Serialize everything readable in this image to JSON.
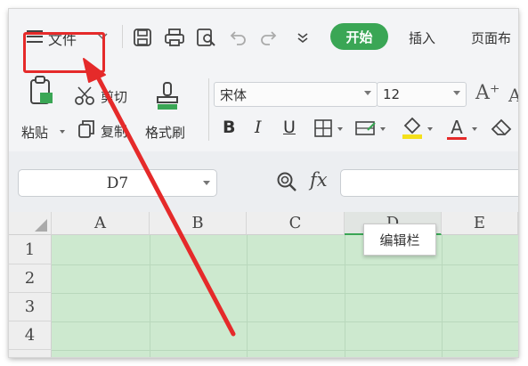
{
  "quick_toolbar": {
    "file_menu_label": "文件",
    "start_tab": "开始",
    "insert_tab": "插入",
    "page_layout_tab": "页面布"
  },
  "ribbon": {
    "paste_label": "粘贴",
    "cut_label": "剪切",
    "copy_label": "复制",
    "format_painter_label": "格式刷",
    "font_name": "宋体",
    "font_size": "12",
    "bold": "B",
    "italic": "I",
    "underline": "U",
    "font_color_letter": "A",
    "grow_font": "A⁺",
    "shrink_font": "A"
  },
  "formula_bar": {
    "cell_reference": "D7",
    "fx_label": "fx",
    "tooltip": "编辑栏"
  },
  "sheet": {
    "columns": [
      "A",
      "B",
      "C",
      "D",
      "E"
    ],
    "rows": [
      "1",
      "2",
      "3",
      "4"
    ]
  },
  "colors": {
    "accent_green": "#3aa655",
    "cell_fill": "#cde9cf",
    "annotation_red": "#e52a2a"
  }
}
